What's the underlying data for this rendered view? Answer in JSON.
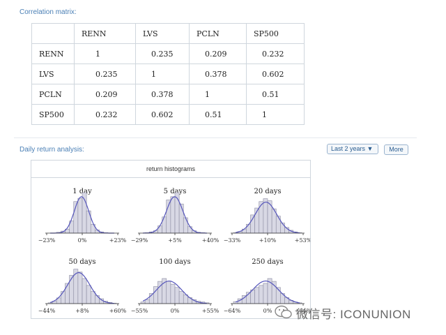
{
  "correlation": {
    "title": "Correlation matrix:",
    "headers": [
      "",
      "RENN",
      "LVS",
      "PCLN",
      "SP500"
    ],
    "rows": [
      [
        "RENN",
        "1",
        "0.235",
        "0.209",
        "0.232"
      ],
      [
        "LVS",
        "0.235",
        "1",
        "0.378",
        "0.602"
      ],
      [
        "PCLN",
        "0.209",
        "0.378",
        "1",
        "0.51"
      ],
      [
        "SP500",
        "0.232",
        "0.602",
        "0.51",
        "1"
      ]
    ]
  },
  "daily": {
    "title": "Daily return analysis:",
    "range_select": "Last 2 years ▼",
    "more_label": "More"
  },
  "histograms": {
    "header": "return histograms",
    "bar_color": "#d8d8e4",
    "curve_color": "#5555bb",
    "panels": [
      {
        "title": "1 day",
        "ticks": [
          "−23%",
          "0%",
          "+23%"
        ],
        "bars": [
          0,
          0,
          0.02,
          0.05,
          0.1,
          0.3,
          0.78,
          0.86,
          1.0,
          0.55,
          0.22,
          0.08,
          0.03,
          0.01,
          0,
          0
        ]
      },
      {
        "title": "5 days",
        "ticks": [
          "−29%",
          "+5%",
          "+40%"
        ],
        "bars": [
          0,
          0.01,
          0.03,
          0.06,
          0.18,
          0.4,
          0.82,
          0.9,
          1.0,
          0.72,
          0.38,
          0.16,
          0.06,
          0.02,
          0.01,
          0
        ]
      },
      {
        "title": "20 days",
        "ticks": [
          "−33%",
          "+10%",
          "+53%"
        ],
        "bars": [
          0.01,
          0.04,
          0.1,
          0.22,
          0.45,
          0.62,
          0.78,
          0.85,
          0.8,
          0.6,
          0.42,
          0.25,
          0.14,
          0.07,
          0.03,
          0.01
        ]
      },
      {
        "title": "50 days",
        "ticks": [
          "−44%",
          "+8%",
          "+60%"
        ],
        "bars": [
          0.02,
          0.06,
          0.14,
          0.3,
          0.5,
          0.7,
          0.85,
          0.78,
          0.62,
          0.45,
          0.3,
          0.2,
          0.12,
          0.06,
          0.03,
          0.01
        ]
      },
      {
        "title": "100 days",
        "ticks": [
          "−55%",
          "0%",
          "+55%"
        ],
        "bars": [
          0.04,
          0.1,
          0.25,
          0.42,
          0.55,
          0.62,
          0.55,
          0.48,
          0.4,
          0.3,
          0.22,
          0.15,
          0.1,
          0.06,
          0.04,
          0.02
        ]
      },
      {
        "title": "250 days",
        "ticks": [
          "−64%",
          "0%",
          "+64%"
        ],
        "bars": [
          0.05,
          0.12,
          0.2,
          0.28,
          0.34,
          0.4,
          0.45,
          0.5,
          0.62,
          0.55,
          0.4,
          0.25,
          0.15,
          0.08,
          0.04,
          0.02
        ]
      }
    ]
  },
  "watermark": {
    "text": "微信号: ICONUNION"
  }
}
